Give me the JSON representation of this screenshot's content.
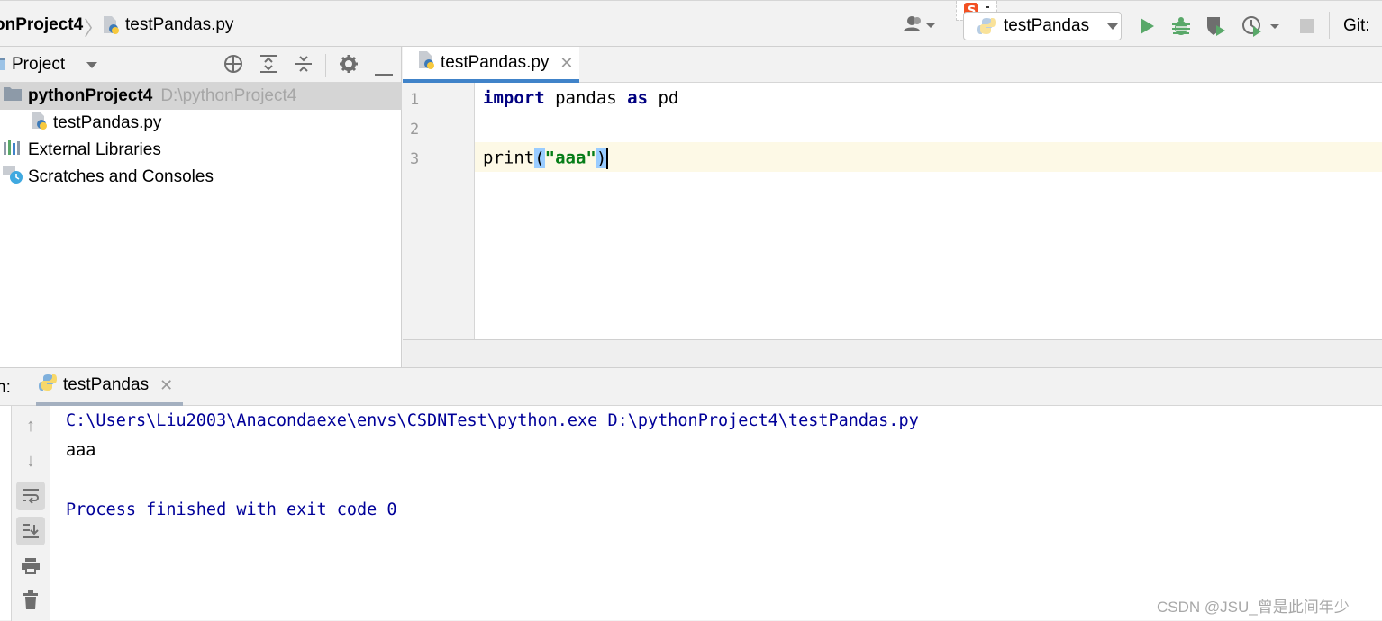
{
  "navbar": {
    "breadcrumb_project": "onProject4",
    "breadcrumb_separator": "〉",
    "breadcrumb_file": "testPandas.py",
    "run_config": "testPandas",
    "git_label": "Git:"
  },
  "project_panel": {
    "title": "Project",
    "tree": [
      {
        "label": "pythonProject4",
        "hint": "D:\\pythonProject4",
        "icon": "folder-icon",
        "selected": true
      },
      {
        "label": "testPandas.py",
        "icon": "python-file-icon"
      },
      {
        "label": "External Libraries",
        "icon": "libraries-icon"
      },
      {
        "label": "Scratches and Consoles",
        "icon": "scratches-icon"
      }
    ]
  },
  "editor": {
    "tab_label": "testPandas.py",
    "lines": [
      {
        "num": "1",
        "tokens": {
          "kw1": "import",
          "t1": " pandas ",
          "kw2": "as",
          "t2": " pd"
        }
      },
      {
        "num": "2"
      },
      {
        "num": "3",
        "tokens": {
          "fn": "print",
          "open": "(",
          "str": "\"aaa\"",
          "close": ")"
        }
      }
    ]
  },
  "run_panel": {
    "label_prefix": "n:",
    "tab_label": "testPandas",
    "console": [
      "C:\\Users\\Liu2003\\Anacondaexe\\envs\\CSDNTest\\python.exe D:\\pythonProject4\\testPandas.py",
      "aaa",
      "",
      "Process finished with exit code 0"
    ]
  },
  "watermark": "CSDN @JSU_曾是此间年少",
  "colors": {
    "accent": "#4083c9",
    "keyword": "#000080",
    "string": "#067d17",
    "console_blue": "#000099",
    "run_green": "#59a869",
    "current_line": "#fdf9e6"
  }
}
